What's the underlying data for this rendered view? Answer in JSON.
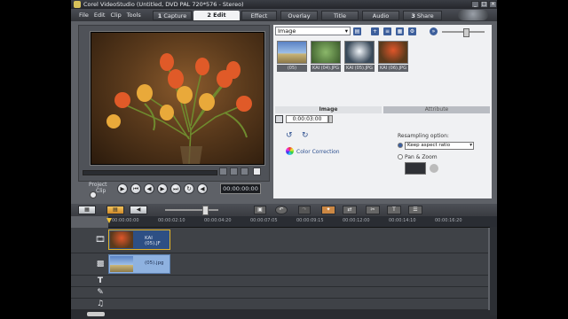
{
  "window": {
    "title": "Corel VideoStudio (Untitled, DVD PAL 720*576 - Stereo)"
  },
  "menu": [
    "File",
    "Edit",
    "Clip",
    "Tools"
  ],
  "steps": [
    {
      "num": "1",
      "label": "Capture"
    },
    {
      "num": "2",
      "label": "Edit"
    },
    {
      "label": "Effect"
    },
    {
      "label": "Overlay"
    },
    {
      "label": "Title"
    },
    {
      "label": "Audio"
    },
    {
      "num": "3",
      "label": "Share"
    }
  ],
  "preview": {
    "project_label": "Project",
    "clip_label": "Clip",
    "timecode": "00:00:00:00"
  },
  "library": {
    "category": "Image",
    "thumbnails": [
      "(05)",
      "KAI (04).JPG",
      "KAI (05).JPG",
      "KAI (06).JPG"
    ]
  },
  "options": {
    "tabs": [
      "Image",
      "Attribute"
    ],
    "duration": "0:00:03:00",
    "color_correction": "Color Correction",
    "resampling_label": "Resampling option:",
    "resampling_value": "Keep aspect ratio",
    "pan_zoom": "Pan & Zoom"
  },
  "timeline": {
    "ticks": [
      "00:00:00:00",
      "00:00:02:10",
      "00:00:04:20",
      "00:00:07:05",
      "00:00:09:15",
      "00:00:12:00",
      "00:00:14:10",
      "00:00:16:20"
    ],
    "clips": [
      {
        "track": "video",
        "name": "KAI (05).JF"
      },
      {
        "track": "overlay",
        "name": "(05).jpg"
      }
    ]
  },
  "colors": {
    "app_bg": "#5e6167",
    "panel_bg": "#f0f1f3",
    "clip_video": "#2d4f84",
    "clip_overlay": "#8fb2e0",
    "accent": "#e4b52a"
  }
}
